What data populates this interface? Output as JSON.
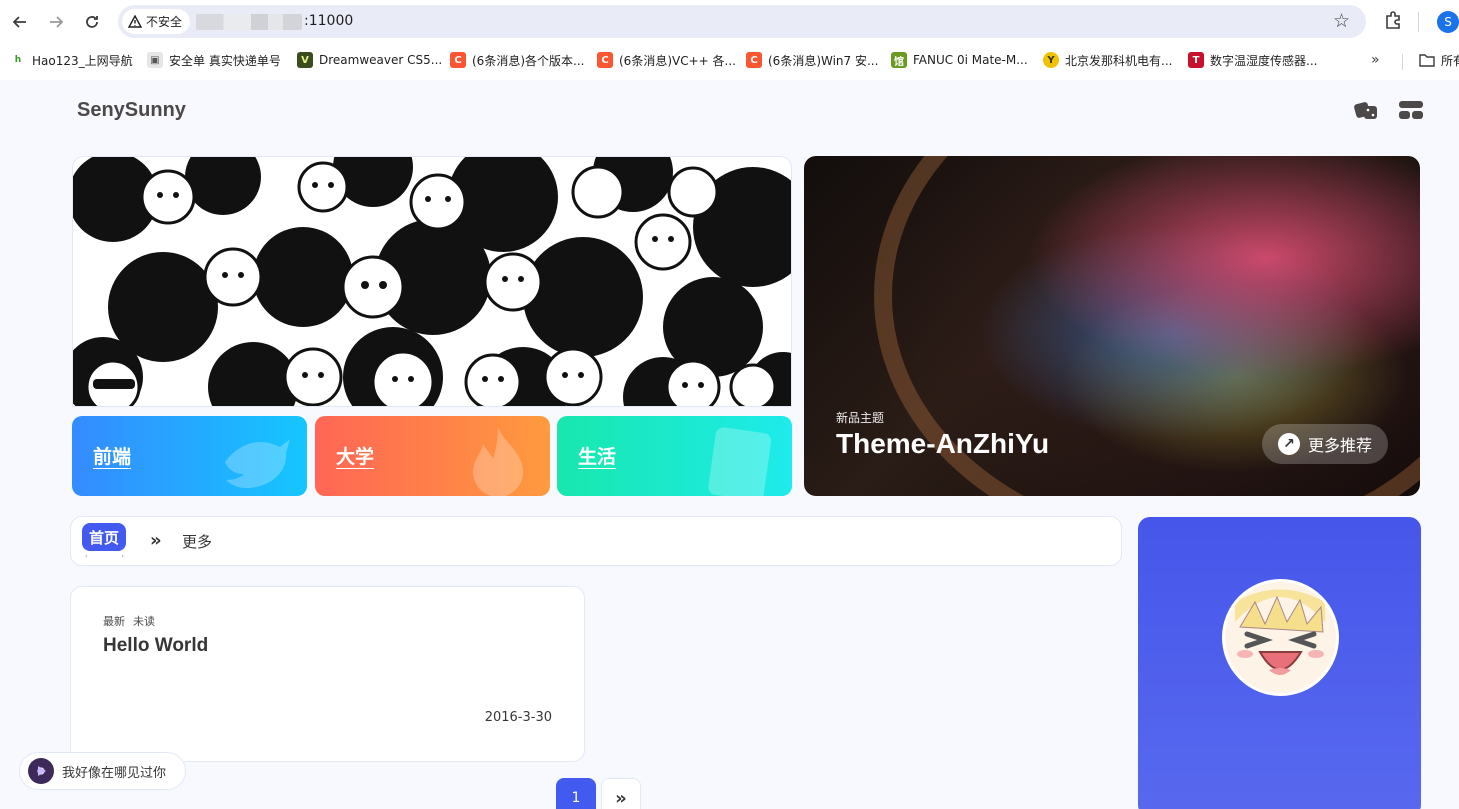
{
  "browser": {
    "security_label": "不安全",
    "url_suffix": ":11000",
    "profile_initial": "S",
    "bookmarks": [
      {
        "label": "Hao123_上网导航",
        "icon": "hao123-icon",
        "color": "#2e9a1f"
      },
      {
        "label": "安全单 真实快递单号",
        "icon": "package-icon",
        "color": "#9e9e9e"
      },
      {
        "label": "Dreamweaver CS5...",
        "icon": "dreamweaver-icon",
        "color": "#3b4d1c"
      },
      {
        "label": "(6条消息)各个版本...",
        "icon": "csdn-icon",
        "color": "#fc5531"
      },
      {
        "label": "(6条消息)VC++ 各...",
        "icon": "csdn-icon",
        "color": "#fc5531"
      },
      {
        "label": "(6条消息)Win7 安...",
        "icon": "csdn-icon",
        "color": "#fc5531"
      },
      {
        "label": "FANUC 0i Mate-M...",
        "icon": "fanuc-icon",
        "color": "#6a9a1f"
      },
      {
        "label": "北京发那科机电有...",
        "icon": "fanuc-logo-icon",
        "color": "#f2c200"
      },
      {
        "label": "数字温湿度传感器...",
        "icon": "t-icon",
        "color": "#c8102e"
      }
    ],
    "bookmarks_overflow": "»",
    "all_bookmarks_label": "所有"
  },
  "site": {
    "title": "SenySunny"
  },
  "categories": [
    {
      "label": "前端",
      "color_from": "#358bff",
      "color_to": "#15c6ff",
      "icon": "bird-icon"
    },
    {
      "label": "大学",
      "color_from": "#f65",
      "color_to": "#ff9a3e",
      "icon": "fire-icon"
    },
    {
      "label": "生活",
      "color_from": "#18e7ae",
      "color_to": "#1eebeb",
      "icon": "book-icon"
    }
  ],
  "feature": {
    "tag": "新品主题",
    "title": "Theme-AnZhiYu",
    "more_label": "更多推荐",
    "more_icon": "↗"
  },
  "category_bar": {
    "home_label": "首页",
    "more_label": "更多"
  },
  "post": {
    "tag_new": "最新",
    "tag_unread": "未读",
    "title": "Hello World",
    "date": "2016-3-30"
  },
  "pagination": {
    "current": "1",
    "next_icon": "»"
  },
  "music": {
    "title": "我好像在哪见过你"
  },
  "colors": {
    "accent": "#425aef",
    "page_bg": "#f7f9fe"
  }
}
